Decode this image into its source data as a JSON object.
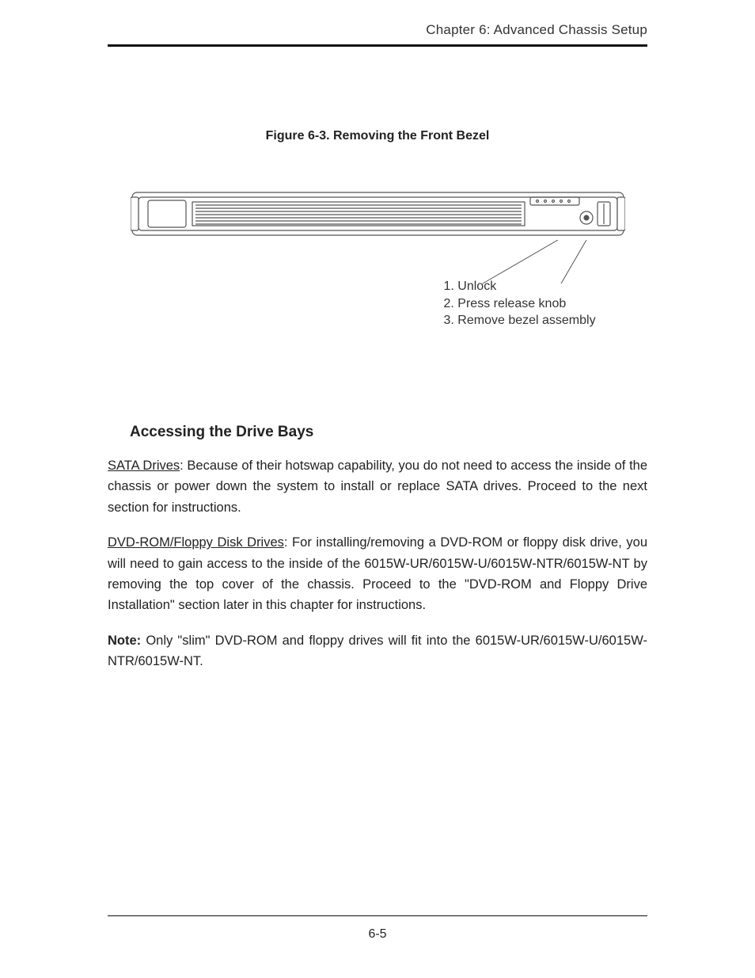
{
  "header": {
    "chapter_line": "Chapter 6: Advanced Chassis Setup"
  },
  "figure": {
    "caption": "Figure 6-3. Removing the Front Bezel",
    "steps": [
      "1. Unlock",
      "2. Press release knob",
      "3. Remove bezel assembly"
    ]
  },
  "section": {
    "title": "Accessing the Drive Bays",
    "p1_lead": "SATA Drives",
    "p1_rest": ": Because of their hotswap capability, you do not need to access the inside of the chassis or power down the system to install or replace SATA drives. Proceed to the next section for instructions.",
    "p2_lead": "DVD-ROM/Floppy Disk Drives",
    "p2_rest": ": For installing/removing a DVD-ROM or floppy disk drive, you will need to gain access to the inside of the 6015W-UR/6015W-U/6015W-NTR/6015W-NT by removing the top cover of the chassis. Proceed to the \"DVD-ROM and Floppy Drive Installation\" section later in this chapter for instructions.",
    "p3_lead": "Note:",
    "p3_rest": " Only \"slim\" DVD-ROM and floppy drives will fit into the 6015W-UR/6015W-U/6015W-NTR/6015W-NT."
  },
  "footer": {
    "page_number": "6-5"
  }
}
